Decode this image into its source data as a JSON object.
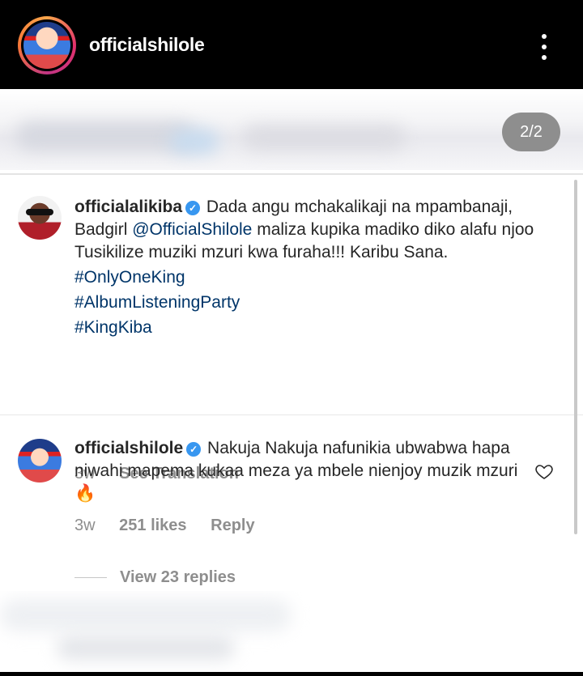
{
  "header": {
    "username": "officialshilole",
    "more_icon": "more-vertical-icon"
  },
  "media": {
    "page_indicator": "2/2"
  },
  "comments": [
    {
      "username": "officialalikiba",
      "verified": true,
      "text_part1": "Dada angu mchakalikaji na mpambanaji, Badgirl ",
      "mention": "@OfficialShilole",
      "text_part2": " maliza kupika madiko diko alafu njoo Tusikilize muziki mzuri kwa furaha!!! Karibu Sana.",
      "hashtags": [
        "#OnlyOneKing",
        "#AlbumListeningParty",
        "#KingKiba"
      ],
      "time": "3w",
      "action": "See Translation"
    },
    {
      "username": "officialshilole",
      "verified": true,
      "text": "Nakuja Nakuja nafunikia ubwabwa hapa niwahi mapema kukaa meza ya mbele nienjoy muzik mzuri",
      "emoji": "🔥",
      "time": "3w",
      "likes": "251 likes",
      "action": "Reply",
      "view_replies": "View 23 replies"
    }
  ],
  "colors": {
    "link": "#003569",
    "verified": "#3897f0",
    "meta": "#8e8e8e",
    "text": "#262626"
  }
}
